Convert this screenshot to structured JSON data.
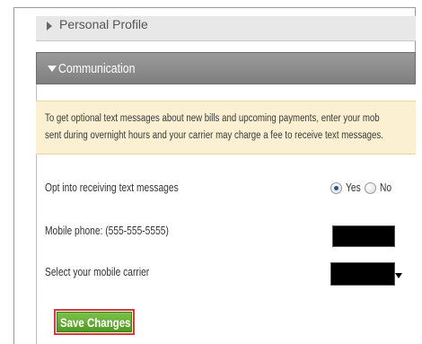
{
  "sections": {
    "personal_profile": {
      "label": "Personal Profile",
      "expanded": false
    },
    "communication": {
      "label": "Communication",
      "expanded": true
    }
  },
  "notice": {
    "line1": "To get optional text messages about new bills and upcoming payments, enter your mob",
    "line2": "sent during overnight hours and your carrier may charge a fee to receive text messages."
  },
  "form": {
    "opt_in": {
      "label": "Opt into receiving text messages",
      "options": [
        {
          "label": "Yes",
          "selected": true
        },
        {
          "label": "No",
          "selected": false
        }
      ]
    },
    "mobile_phone": {
      "label": "Mobile phone: (555-555-5555)"
    },
    "carrier": {
      "label": "Select your mobile carrier"
    }
  },
  "actions": {
    "save_label": "Save Changes"
  },
  "colors": {
    "header_gray": "#8a8a8a",
    "notice_bg": "#fbf0d2",
    "save_green": "#5fab2e",
    "highlight_red": "#d63a3a"
  }
}
